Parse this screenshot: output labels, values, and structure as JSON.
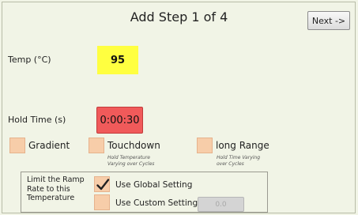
{
  "header": {
    "title": "Add Step 1 of 4",
    "next_label": "Next ->"
  },
  "temperature": {
    "label": "Temp (°C)",
    "value": "95"
  },
  "hold_time": {
    "label": "Hold Time (s)",
    "value": "0:00:30"
  },
  "options": {
    "gradient": {
      "label": "Gradient"
    },
    "touchdown": {
      "label": "Touchdown",
      "sub_1": "Hold Temperature",
      "sub_2": "Varying over Cycles"
    },
    "long_range": {
      "label": "long Range",
      "sub_1": "Hold Time Varying",
      "sub_2": "over Cycles"
    }
  },
  "ramp": {
    "line_1": "Limit the Ramp",
    "line_2": "Rate to this",
    "line_3": "Temperature",
    "global_label": "Use Global Setting",
    "global_checked": true,
    "custom_label": "Use Custom Setting",
    "custom_checked": false,
    "custom_button_label": "0.0"
  },
  "colors": {
    "temp_field": "#ffff40",
    "hold_field": "#f05a5a",
    "checkbox": "#f7cda9",
    "background": "#f1f4e6"
  }
}
